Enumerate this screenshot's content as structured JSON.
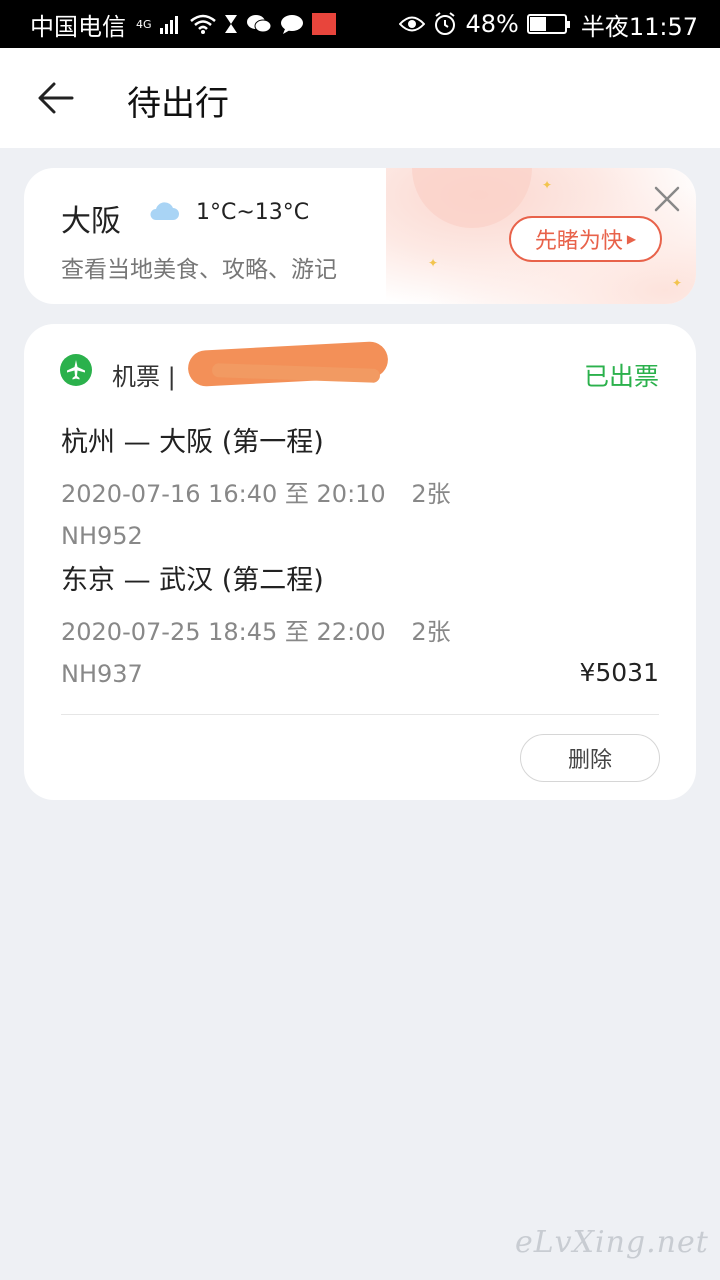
{
  "status_bar": {
    "carrier": "中国电信",
    "network": "4G",
    "battery": "48%",
    "time": "半夜11:57"
  },
  "header": {
    "title": "待出行"
  },
  "destination": {
    "city": "大阪",
    "weather_icon": "cloud-icon",
    "temperature": "1°C~13°C",
    "subtitle": "查看当地美食、攻略、游记",
    "promo_label": "先睹为快"
  },
  "order": {
    "type_label": "机票 |",
    "status": "已出票",
    "legs": [
      {
        "route": "杭州 — 大阪 (第一程)",
        "datetime": "2020-07-16 16:40 至 20:10",
        "tickets": "2张",
        "flight": "NH952"
      },
      {
        "route": "东京 — 武汉 (第二程)",
        "datetime": "2020-07-25 18:45 至 22:00",
        "tickets": "2张",
        "flight": "NH937"
      }
    ],
    "price": "¥5031",
    "delete_label": "删除"
  },
  "watermark": "eLvXing.net",
  "colors": {
    "accent_green": "#2bb14c",
    "promo_orange": "#e8624a",
    "page_bg": "#eef0f4"
  }
}
